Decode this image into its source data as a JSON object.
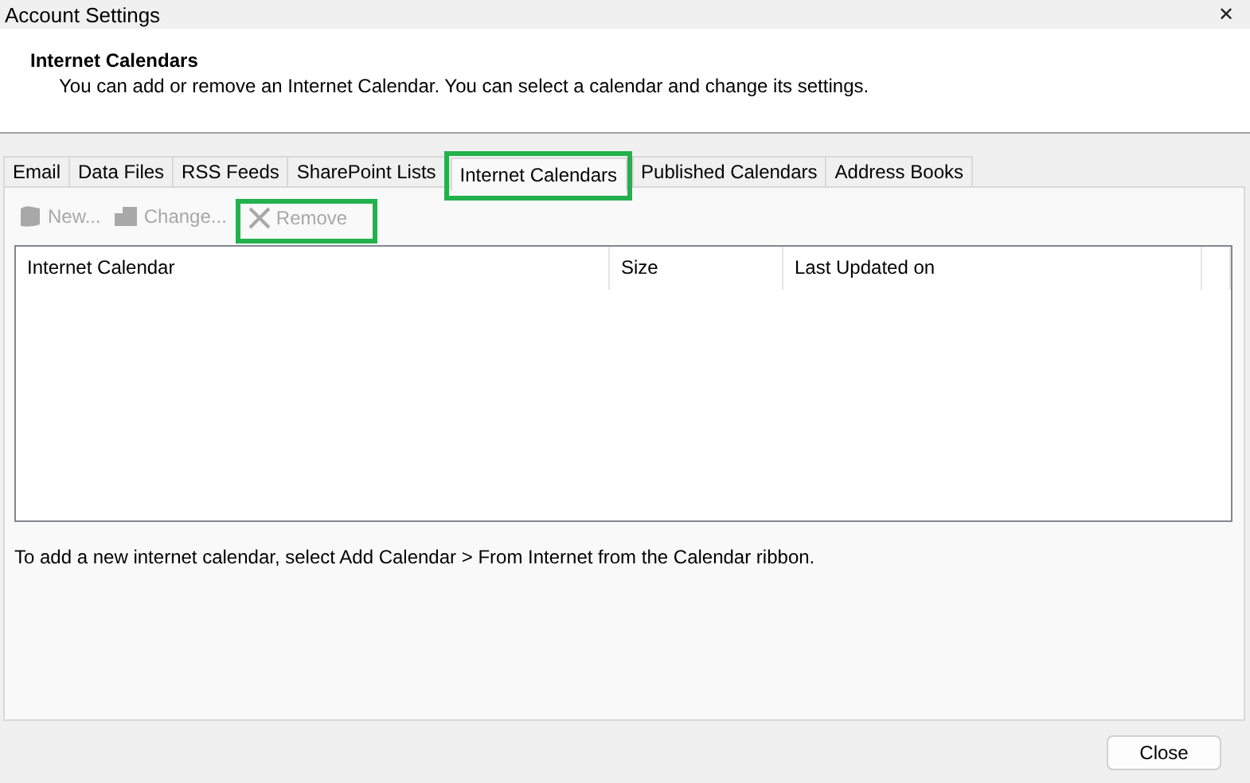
{
  "window": {
    "title": "Account Settings",
    "close": "✕"
  },
  "header": {
    "title": "Internet Calendars",
    "description": "You can add or remove an Internet Calendar. You can select a calendar and change its settings."
  },
  "tabs": [
    {
      "label": "Email",
      "selected": false,
      "highlighted": false
    },
    {
      "label": "Data Files",
      "selected": false,
      "highlighted": false
    },
    {
      "label": "RSS Feeds",
      "selected": false,
      "highlighted": false
    },
    {
      "label": "SharePoint Lists",
      "selected": false,
      "highlighted": false
    },
    {
      "label": "Internet Calendars",
      "selected": true,
      "highlighted": true
    },
    {
      "label": "Published Calendars",
      "selected": false,
      "highlighted": false
    },
    {
      "label": "Address Books",
      "selected": false,
      "highlighted": false
    }
  ],
  "toolbar": [
    {
      "kind": "new",
      "label": "New...",
      "disabled": true,
      "highlighted": false
    },
    {
      "kind": "change",
      "label": "Change...",
      "disabled": true,
      "highlighted": false
    },
    {
      "kind": "remove",
      "label": "Remove",
      "disabled": true,
      "highlighted": true
    }
  ],
  "table": {
    "columns": [
      "Internet Calendar",
      "Size",
      "Last Updated on"
    ]
  },
  "hint": "To add a new internet calendar, select Add Calendar > From Internet from the Calendar ribbon.",
  "buttons": [
    "Close"
  ]
}
